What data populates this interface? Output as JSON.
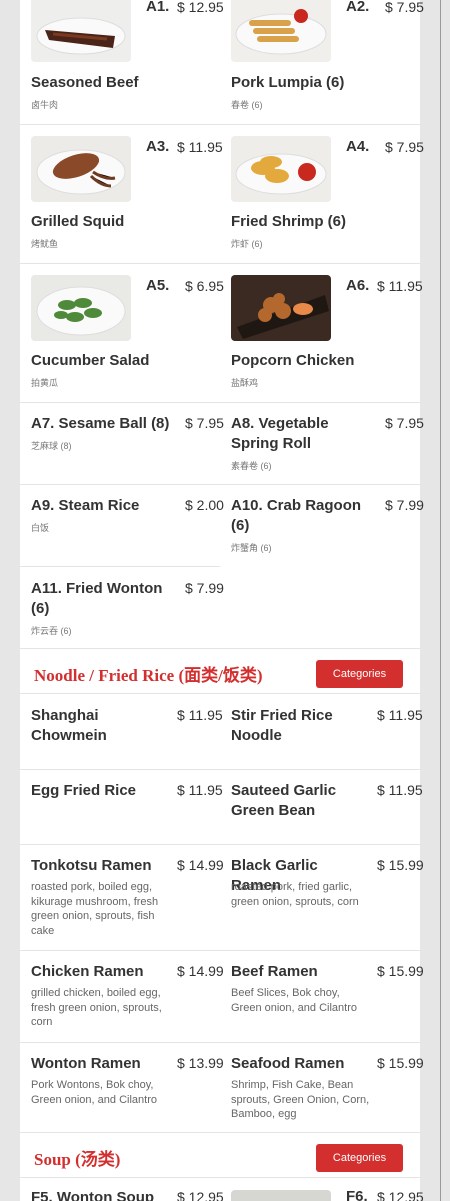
{
  "appetizers": [
    {
      "code": "A1.",
      "price": "$ 12.95",
      "name": "Seasoned Beef",
      "sub": "卤牛肉",
      "image": "seasoned-beef-photo"
    },
    {
      "code": "A2.",
      "price": "$ 7.95",
      "name": "Pork Lumpia (6)",
      "sub": "春卷 (6)",
      "image": "pork-lumpia-photo"
    },
    {
      "code": "A3.",
      "price": "$ 11.95",
      "name": "Grilled Squid",
      "sub": "烤鱿鱼",
      "image": "grilled-squid-photo"
    },
    {
      "code": "A4.",
      "price": "$ 7.95",
      "name": "Fried Shrimp (6)",
      "sub": "炸虾 (6)",
      "image": "fried-shrimp-photo"
    },
    {
      "code": "A5.",
      "price": "$ 6.95",
      "name": "Cucumber Salad",
      "sub": "拍黄瓜",
      "image": "cucumber-salad-photo"
    },
    {
      "code": "A6.",
      "price": "$ 11.95",
      "name": "Popcorn Chicken",
      "sub": "盐酥鸡",
      "image": "popcorn-chicken-photo"
    },
    {
      "name": "A7. Sesame Ball (8)",
      "price": "$ 7.95",
      "sub": "芝麻球 (8)"
    },
    {
      "name": "A8. Vegetable Spring Roll",
      "price": "$ 7.95",
      "sub": "素春卷 (6)"
    },
    {
      "name": "A9. Steam Rice",
      "price": "$ 2.00",
      "sub": "白饭"
    },
    {
      "name": "A10. Crab Ragoon (6)",
      "price": "$ 7.99",
      "sub": "炸蟹角 (6)"
    },
    {
      "name": "A11. Fried Wonton (6)",
      "price": "$ 7.99",
      "sub": "炸云吞 (6)"
    }
  ],
  "noodle_section": {
    "title": "Noodle / Fried Rice (面类/饭类)",
    "button": "Categories",
    "items": [
      {
        "name": "Shanghai Chowmein",
        "price": "$ 11.95",
        "desc": ""
      },
      {
        "name": "Stir Fried Rice Noodle",
        "price": "$ 11.95",
        "desc": ""
      },
      {
        "name": "Egg Fried Rice",
        "price": "$ 11.95",
        "desc": ""
      },
      {
        "name": "Sauteed Garlic Green Bean",
        "price": "$ 11.95",
        "desc": ""
      },
      {
        "name": "Tonkotsu Ramen",
        "price": "$ 14.99",
        "desc": "roasted pork, boiled egg, kikurage mushroom, fresh green onion, sprouts, fish cake"
      },
      {
        "name": "Black Garlic Ramen",
        "price": "$ 15.99",
        "desc": "roasted pork, fried garlic, green onion, sprouts, corn"
      },
      {
        "name": "Chicken Ramen",
        "price": "$ 14.99",
        "desc": "grilled chicken, boiled egg, fresh green onion, sprouts, corn"
      },
      {
        "name": "Beef Ramen",
        "price": "$ 15.99",
        "desc": "Beef Slices, Bok choy, Green onion, and Cilantro"
      },
      {
        "name": "Wonton Ramen",
        "price": "$ 13.99",
        "desc": "Pork Wontons, Bok choy, Green onion, and Cilantro"
      },
      {
        "name": "Seafood Ramen",
        "price": "$ 15.99",
        "desc": "Shrimp, Fish Cake, Bean sprouts, Green Onion, Corn, Bamboo, egg"
      }
    ]
  },
  "soup_section": {
    "title": "Soup (汤类)",
    "button": "Categories",
    "items": [
      {
        "name": "F5. Wonton Soup",
        "price": "$ 12.95"
      },
      {
        "code": "F6.",
        "price": "$ 12.95",
        "image": "soup-photo"
      }
    ]
  },
  "colors": {
    "accent": "#d32f2f",
    "background": "#e6e6e6",
    "text": "#333333"
  }
}
